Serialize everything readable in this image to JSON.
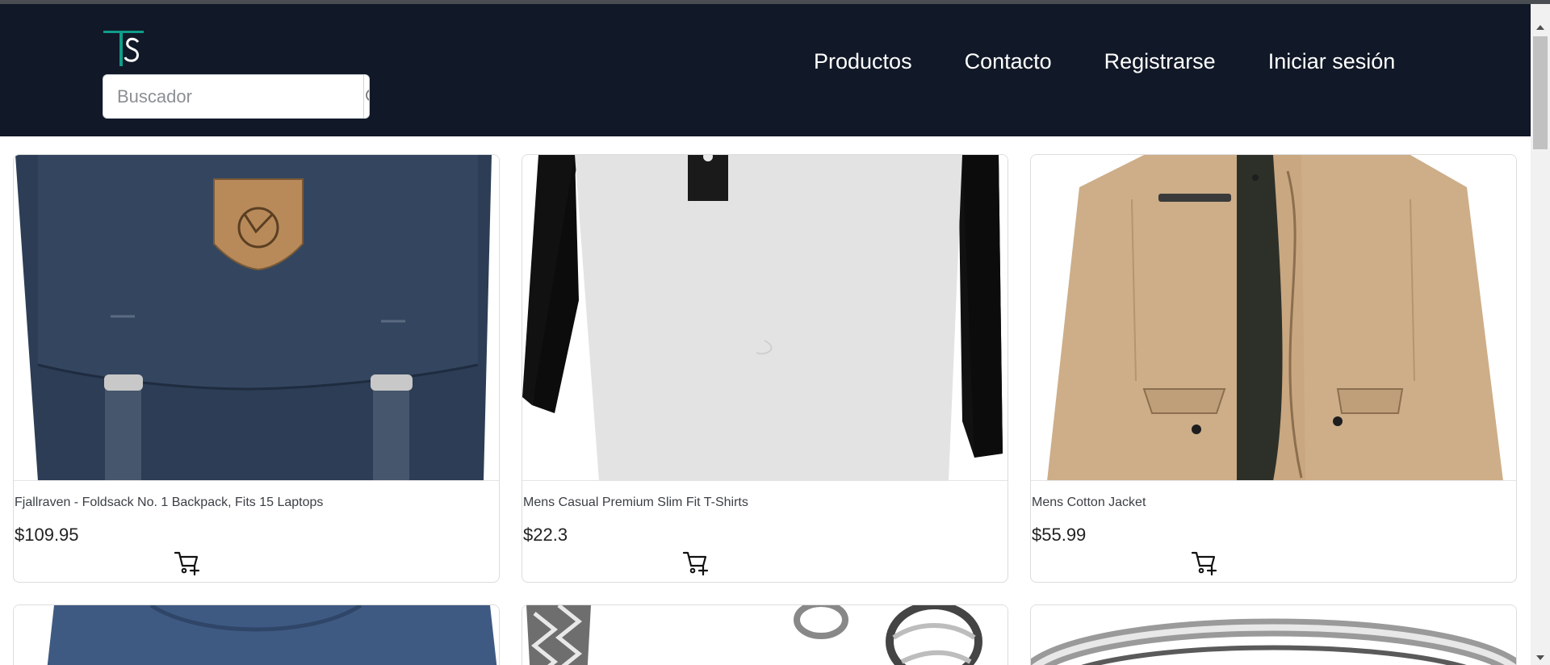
{
  "header": {
    "logo_text": "TS",
    "search_placeholder": "Buscador",
    "nav": [
      "Productos",
      "Contacto",
      "Registrarse",
      "Iniciar sesión"
    ]
  },
  "products": [
    {
      "title": "Fjallraven - Foldsack No. 1 Backpack, Fits 15 Laptops",
      "price": "$109.95",
      "image": "navy-backpack"
    },
    {
      "title": "Mens Casual Premium Slim Fit T-Shirts",
      "price": "$22.3",
      "image": "raglan-tshirt"
    },
    {
      "title": "Mens Cotton Jacket",
      "price": "$55.99",
      "image": "beige-jacket"
    }
  ],
  "products_partial": [
    {
      "image": "blue-tshirt"
    },
    {
      "image": "silver-bracelet"
    },
    {
      "image": "silver-ring"
    }
  ],
  "colors": {
    "navbar": "#111827",
    "accent": "#0f9d8a"
  }
}
